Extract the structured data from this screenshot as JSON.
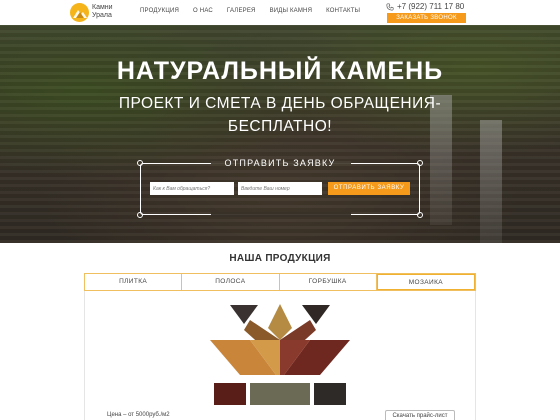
{
  "header": {
    "brand_line1": "Камни",
    "brand_line2": "Урала",
    "nav": [
      "ПРОДУКЦИЯ",
      "О НАС",
      "ГАЛЕРЕЯ",
      "ВИДЫ КАМНЯ",
      "КОНТАКТЫ"
    ],
    "phone": "+7 (922) 711 17 80",
    "call_button": "ЗАКАЗАТЬ ЗВОНОК"
  },
  "hero": {
    "title": "НАТУРАЛЬНЫЙ КАМЕНЬ",
    "subtitle": "ПРОЕКТ И СМЕТА В ДЕНЬ ОБРАЩЕНИЯ- БЕСПЛАТНО!",
    "form_title": "ОТПРАВИТЬ ЗАЯВКУ",
    "name_placeholder": "Как к Вам обращаться?",
    "phone_placeholder": "Введите Ваш номер",
    "submit_label": "ОТПРАВИТЬ ЗАЯВКУ"
  },
  "products": {
    "title": "НАША ПРОДУКЦИЯ",
    "tabs": [
      "ПЛИТКА",
      "ПОЛОСА",
      "ГОРБУШКА",
      "МОЗАИКА"
    ],
    "active_tab": "МОЗАИКА",
    "price": "Цена – от 5000руб./м2",
    "pricelist_button": "Скачать прайс-лист"
  },
  "colors": {
    "accent": "#f59a1b",
    "tab_border": "#f0c060"
  }
}
